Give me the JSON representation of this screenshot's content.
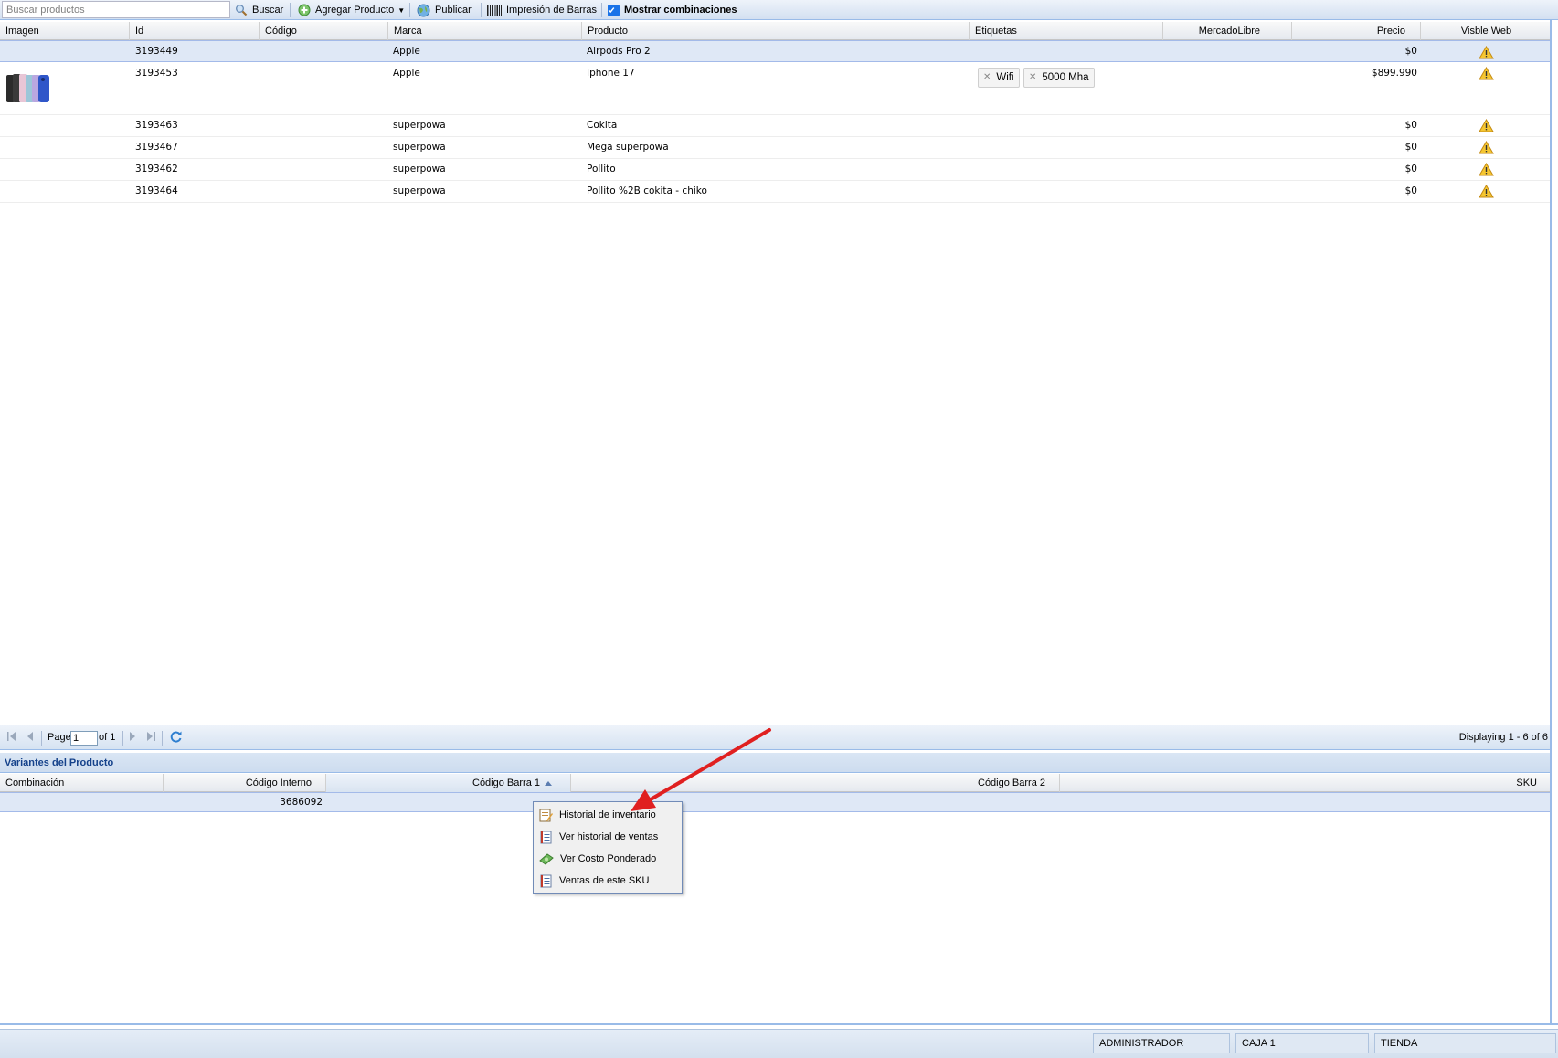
{
  "toolbar": {
    "search_placeholder": "Buscar productos",
    "search_label": "Buscar",
    "add_product_label": "Agregar Producto",
    "publish_label": "Publicar",
    "barcode_print_label": "Impresión de Barras",
    "show_combinations_label": "Mostrar combinaciones",
    "show_combinations_checked": true
  },
  "products_grid": {
    "columns": [
      "Imagen",
      "Id",
      "Código",
      "Marca",
      "Producto",
      "Etiquetas",
      "MercadoLibre",
      "Precio",
      "Visble Web"
    ],
    "rows": [
      {
        "id": "3193449",
        "codigo": "",
        "marca": "Apple",
        "producto": "Airpods Pro 2",
        "etiquetas": [],
        "mercadolibre": "",
        "precio": "$0",
        "visible_web": "warning-icon",
        "has_image": false,
        "selected": true
      },
      {
        "id": "3193453",
        "codigo": "",
        "marca": "Apple",
        "producto": "Iphone 17",
        "etiquetas": [
          "Wifi",
          "5000 Mha"
        ],
        "mercadolibre": "",
        "precio": "$899.990",
        "visible_web": "warning-icon",
        "has_image": true,
        "selected": false
      },
      {
        "id": "3193463",
        "codigo": "",
        "marca": "superpowa",
        "producto": "Cokita",
        "etiquetas": [],
        "mercadolibre": "",
        "precio": "$0",
        "visible_web": "warning-icon",
        "has_image": false,
        "selected": false
      },
      {
        "id": "3193467",
        "codigo": "",
        "marca": "superpowa",
        "producto": "Mega superpowa",
        "etiquetas": [],
        "mercadolibre": "",
        "precio": "$0",
        "visible_web": "warning-icon",
        "has_image": false,
        "selected": false
      },
      {
        "id": "3193462",
        "codigo": "",
        "marca": "superpowa",
        "producto": "Pollito",
        "etiquetas": [],
        "mercadolibre": "",
        "precio": "$0",
        "visible_web": "warning-icon",
        "has_image": false,
        "selected": false
      },
      {
        "id": "3193464",
        "codigo": "",
        "marca": "superpowa",
        "producto": "Pollito %2B cokita - chiko",
        "etiquetas": [],
        "mercadolibre": "",
        "precio": "$0",
        "visible_web": "warning-icon",
        "has_image": false,
        "selected": false
      }
    ]
  },
  "pager": {
    "page_label": "Page",
    "page_value": "1",
    "of_label": "of 1",
    "display_text": "Displaying 1 - 6 of 6"
  },
  "variants_panel": {
    "title": "Variantes del Producto",
    "columns": [
      "Combinación",
      "Código Interno",
      "Código Barra 1",
      "Código Barra 2",
      "SKU"
    ],
    "sorted_column": "Código Barra 1",
    "rows": [
      {
        "combinacion": "",
        "codigo_interno": "3686092",
        "codigo_barra_1": "",
        "codigo_barra_2": "",
        "sku": ""
      }
    ]
  },
  "context_menu": {
    "items": [
      {
        "label": "Historial de inventario",
        "icon": "inventory-history-icon"
      },
      {
        "label": "Ver historial de ventas",
        "icon": "sales-history-icon"
      },
      {
        "label": "Ver Costo Ponderado",
        "icon": "money-icon"
      },
      {
        "label": "Ventas de este SKU",
        "icon": "sku-sales-icon"
      }
    ]
  },
  "status_bar": {
    "user": "ADMINISTRADOR",
    "register": "CAJA 1",
    "store": "TIENDA"
  },
  "colors": {
    "panel_border": "#99bbe8",
    "panel_title": "#15428b",
    "selected_row": "#dfe8f6",
    "annotation_arrow": "#e02020",
    "warning": "#f0c020"
  }
}
